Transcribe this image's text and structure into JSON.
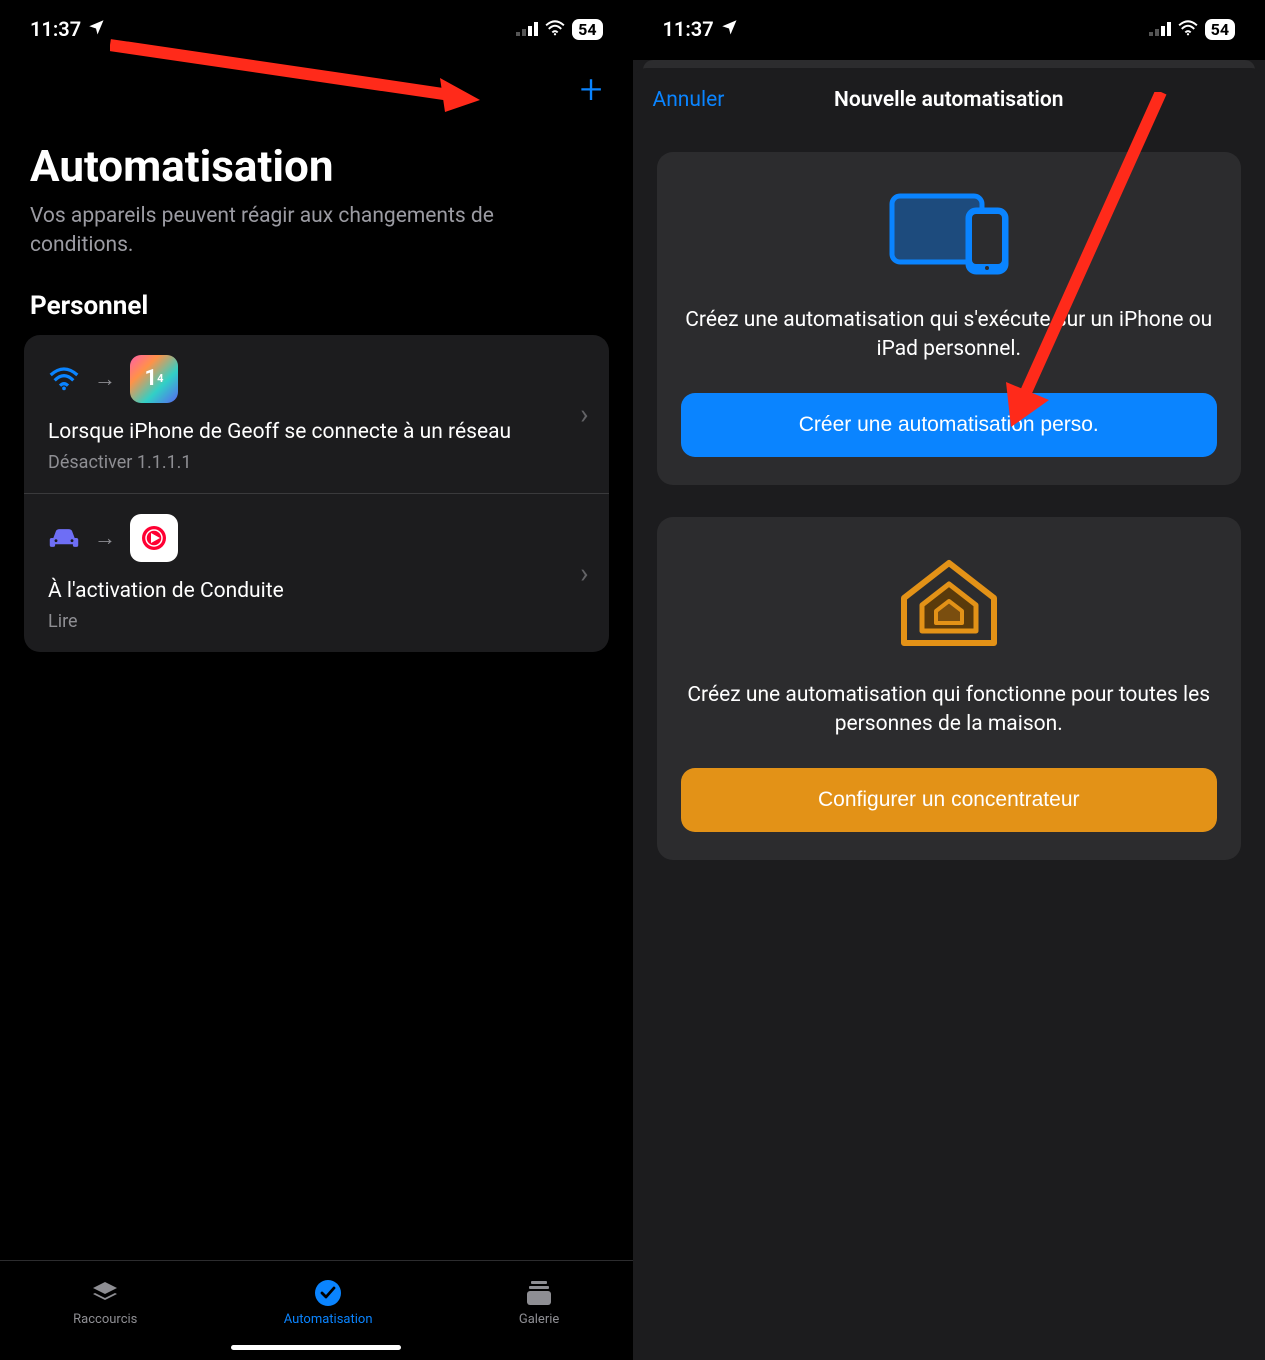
{
  "status": {
    "time": "11:37",
    "battery": "54"
  },
  "left": {
    "title": "Automatisation",
    "subtitle": "Vos appareils peuvent réagir aux changements de conditions.",
    "section": "Personnel",
    "items": [
      {
        "trigger_icon": "wifi",
        "app_icon": "1111",
        "title": "Lorsque iPhone de Geoff se connecte à un réseau",
        "sub": "Désactiver 1.1.1.1"
      },
      {
        "trigger_icon": "car",
        "app_icon": "ytmusic",
        "title": "À l'activation de Conduite",
        "sub": "Lire"
      }
    ],
    "tabs": [
      {
        "label": "Raccourcis",
        "icon": "stack"
      },
      {
        "label": "Automatisation",
        "icon": "check-circle",
        "active": true
      },
      {
        "label": "Galerie",
        "icon": "gallery"
      }
    ]
  },
  "right": {
    "cancel": "Annuler",
    "title": "Nouvelle automatisation",
    "personal": {
      "desc": "Créez une automatisation qui s'exécute sur un iPhone ou iPad personnel.",
      "button": "Créer une automatisation perso."
    },
    "home": {
      "desc": "Créez une automatisation qui fonctionne pour toutes les personnes de la maison.",
      "button": "Configurer un concentrateur"
    }
  }
}
